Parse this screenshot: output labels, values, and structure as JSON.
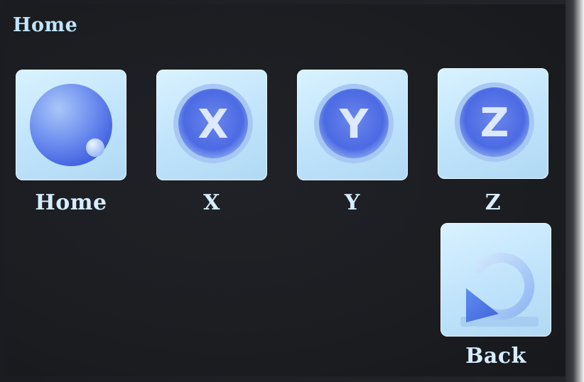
{
  "screen": {
    "title": "Home"
  },
  "buttons": [
    {
      "label": "Home",
      "icon": "home-ball-icon"
    },
    {
      "label": "X",
      "icon": "x-axis-icon",
      "glyph": "X"
    },
    {
      "label": "Y",
      "icon": "y-axis-icon",
      "glyph": "Y"
    },
    {
      "label": "Z",
      "icon": "z-axis-icon",
      "glyph": "Z"
    },
    {
      "label": "Back",
      "icon": "back-arrow-icon"
    }
  ],
  "colors": {
    "background": "#1b1d21",
    "tile": "#c6e8fb",
    "icon_blue": "#4f6fe6",
    "label_text": "#d6edff"
  }
}
